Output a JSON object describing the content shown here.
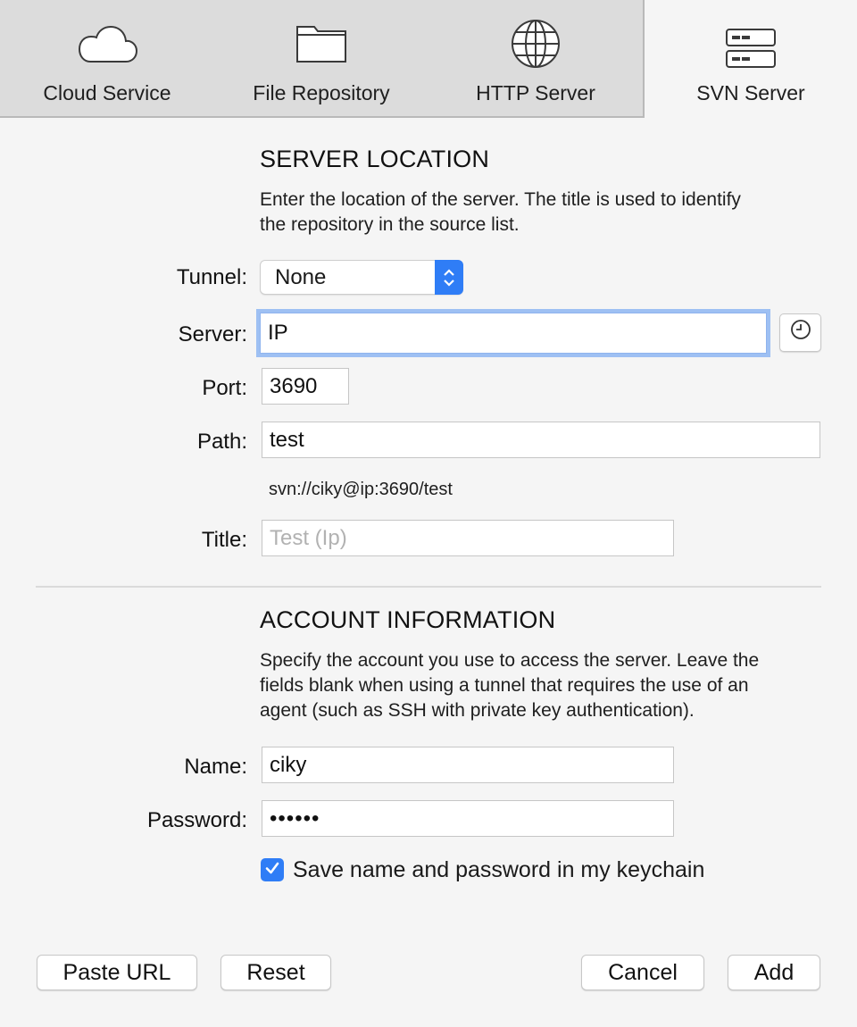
{
  "tabs": [
    {
      "label": "Cloud Service",
      "icon": "cloud-icon"
    },
    {
      "label": "File Repository",
      "icon": "folder-icon"
    },
    {
      "label": "HTTP Server",
      "icon": "globe-icon"
    },
    {
      "label": "SVN Server",
      "icon": "server-icon",
      "active": true
    }
  ],
  "server_location": {
    "heading": "SERVER LOCATION",
    "description_line1": "Enter the location of the server. The title is used to identify",
    "description_line2": "the repository in the source list.",
    "tunnel_label": "Tunnel:",
    "tunnel_value": "None",
    "server_label": "Server:",
    "server_value": "IP",
    "port_label": "Port:",
    "port_value": "3690",
    "path_label": "Path:",
    "path_value": "test",
    "url_preview": "svn://ciky@ip:3690/test",
    "title_label": "Title:",
    "title_placeholder": "Test (Ip)"
  },
  "account": {
    "heading": "ACCOUNT INFORMATION",
    "description_line1": "Specify the account you use to access the server. Leave the",
    "description_line2": "fields blank when using a tunnel that requires the use of an",
    "description_line3": "agent (such as SSH with private key authentication).",
    "name_label": "Name:",
    "name_value": "ciky",
    "password_label": "Password:",
    "password_value": "••••••",
    "keychain_label": "Save name and password in my keychain",
    "keychain_checked": true
  },
  "buttons": {
    "paste_url": "Paste URL",
    "reset": "Reset",
    "cancel": "Cancel",
    "add": "Add"
  },
  "colors": {
    "accent": "#2f7df6",
    "focus_ring": "#9ec0f3"
  }
}
